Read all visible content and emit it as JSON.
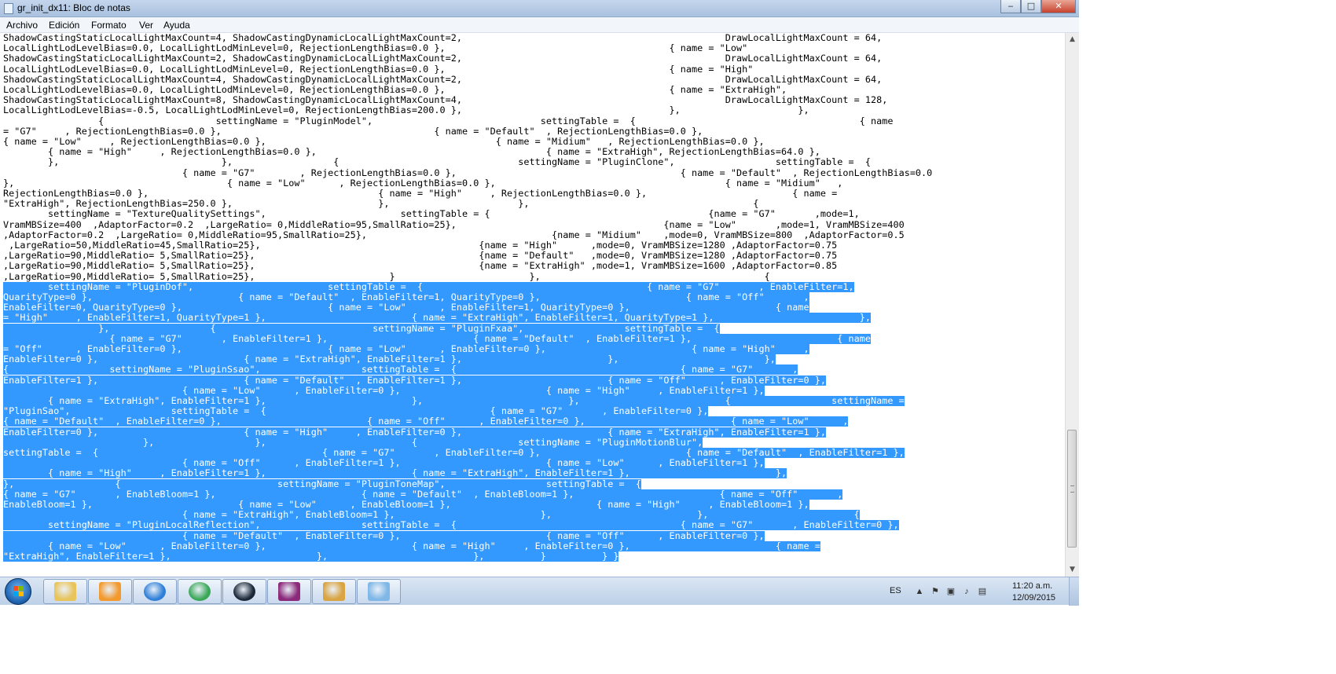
{
  "window": {
    "title": "gr_init_dx11: Bloc de notas"
  },
  "window_buttons": {
    "minimize": "‒",
    "maximize": "□",
    "close": "✕"
  },
  "menu": {
    "items": [
      "Archivo",
      "Edición",
      "Formato",
      "Ver",
      "Ayuda"
    ]
  },
  "editor": {
    "lines": [
      {
        "text": "ShadowCastingStaticLocalLightMaxCount=4, ShadowCastingDynamicLocalLightMaxCount=2,                                               DrawLocalLightMaxCount = 64,",
        "sel": false
      },
      {
        "text": "LocalLightLodLevelBias=0.0, LocalLightLodMinLevel=0, RejectionLengthBias=0.0 },                                        { name = \"Low\"",
        "sel": false
      },
      {
        "text": "ShadowCastingStaticLocalLightMaxCount=2, ShadowCastingDynamicLocalLightMaxCount=2,                                               DrawLocalLightMaxCount = 64,",
        "sel": false
      },
      {
        "text": "LocalLightLodLevelBias=0.0, LocalLightLodMinLevel=0, RejectionLengthBias=0.0 },                                        { name = \"High\"",
        "sel": false
      },
      {
        "text": "ShadowCastingStaticLocalLightMaxCount=4, ShadowCastingDynamicLocalLightMaxCount=2,                                               DrawLocalLightMaxCount = 64,",
        "sel": false
      },
      {
        "text": "LocalLightLodLevelBias=0.0, LocalLightLodMinLevel=0, RejectionLengthBias=0.0 },                                        { name = \"ExtraHigh\",",
        "sel": false
      },
      {
        "text": "ShadowCastingStaticLocalLightMaxCount=8, ShadowCastingDynamicLocalLightMaxCount=4,                                               DrawLocalLightMaxCount = 128,",
        "sel": false
      },
      {
        "text": "LocalLightLodLevelBias=-0.5, LocalLightLodMinLevel=0, RejectionLengthBias=200.0 },                                     },                     },",
        "sel": false
      },
      {
        "text": "                 {                    settingName = \"PluginModel\",                              settingTable =  {                                        { name",
        "sel": false
      },
      {
        "text": "= \"G7\"     , RejectionLengthBias=0.0 },                                      { name = \"Default\"  , RejectionLengthBias=0.0 },",
        "sel": false
      },
      {
        "text": "{ name = \"Low\"     , RejectionLengthBias=0.0 },                                         { name = \"Midium\"   , RejectionLengthBias=0.0 },",
        "sel": false
      },
      {
        "text": "        { name = \"High\"     , RejectionLengthBias=0.0 },                                         { name = \"ExtraHigh\", RejectionLengthBias=64.0 },",
        "sel": false
      },
      {
        "text": "        },                             },                  {                                settingName = \"PluginClone\",                  settingTable =  {",
        "sel": false
      },
      {
        "text": "                                { name = \"G7\"        , RejectionLengthBias=0.0 },                                        { name = \"Default\"  , RejectionLengthBias=0.0",
        "sel": false
      },
      {
        "text": "},                                      { name = \"Low\"      , RejectionLengthBias=0.0 },                                         { name = \"Midium\"   ,",
        "sel": false
      },
      {
        "text": "RejectionLengthBias=0.0 },                                         { name = \"High\"     , RejectionLengthBias=0.0 },                          { name =",
        "sel": false
      },
      {
        "text": "\"ExtraHigh\", RejectionLengthBias=250.0 },                          },                       },                                        {",
        "sel": false
      },
      {
        "text": "        settingName = \"TextureQualitySettings\",                        settingTable = {                                       {name = \"G7\"       ,mode=1,",
        "sel": false
      },
      {
        "text": "VramMBSize=400  ,AdaptorFactor=0.2  ,LargeRatio= 0,MiddleRatio=95,SmallRatio=25},                                     {name = \"Low\"       ,mode=1, VramMBSize=400",
        "sel": false
      },
      {
        "text": ",AdaptorFactor=0.2  ,LargeRatio= 0,MiddleRatio=95,SmallRatio=25},                                 {name = \"Midium\"    ,mode=0, VramMBSize=800  ,AdaptorFactor=0.5",
        "sel": false
      },
      {
        "text": " ,LargeRatio=50,MiddleRatio=45,SmallRatio=25},                                       {name = \"High\"      ,mode=0, VramMBSize=1280 ,AdaptorFactor=0.75",
        "sel": false
      },
      {
        "text": ",LargeRatio=90,MiddleRatio= 5,SmallRatio=25},                                        {name = \"Default\"   ,mode=0, VramMBSize=1280 ,AdaptorFactor=0.75",
        "sel": false
      },
      {
        "text": ",LargeRatio=90,MiddleRatio= 5,SmallRatio=25},                                        {name = \"ExtraHigh\" ,mode=1, VramMBSize=1600 ,AdaptorFactor=0.85",
        "sel": false
      },
      {
        "text": ",LargeRatio=90,MiddleRatio= 5,SmallRatio=25},                        }                        },                                        {",
        "sel": false
      },
      {
        "text": "        settingName = \"PluginDof\",                        settingTable =  {                                        { name = \"G7\"       , EnableFilter=1,",
        "sel": true
      },
      {
        "text": "QuarityType=0 },                          { name = \"Default\"  , EnableFilter=1, QuarityType=0 },                          { name = \"Off\"       ,",
        "sel": true
      },
      {
        "text": "EnableFilter=0, QuarityType=0 },                          { name = \"Low\"      , EnableFilter=1, QuarityType=0 },                          { name",
        "sel": true
      },
      {
        "text": "= \"High\"     , EnableFilter=1, QuarityType=1 },                          { name = \"ExtraHigh\", EnableFilter=1, QuarityType=1 },                          },",
        "sel": true
      },
      {
        "text": "                 },                  {                            settingName = \"PluginFxaa\",                  settingTable =  {",
        "sel": true
      },
      {
        "text": "                   { name = \"G7\"       , EnableFilter=1 },                          { name = \"Default\"  , EnableFilter=1 },                          { name",
        "sel": true
      },
      {
        "text": "= \"Off\"      , EnableFilter=0 },                          { name = \"Low\"      , EnableFilter=0 },                          { name = \"High\"     ,",
        "sel": true
      },
      {
        "text": "EnableFilter=0 },                          { name = \"ExtraHigh\", EnableFilter=1 },                          },                          },",
        "sel": true
      },
      {
        "text": "{                  settingName = \"PluginSsao\",                  settingTable =  {                                        { name = \"G7\"       ,",
        "sel": true
      },
      {
        "text": "EnableFilter=1 },                          { name = \"Default\"  , EnableFilter=1 },                          { name = \"Off\"      , EnableFilter=0 },",
        "sel": true
      },
      {
        "text": "                                { name = \"Low\"      , EnableFilter=0 },                          { name = \"High\"     , EnableFilter=1 },",
        "sel": true
      },
      {
        "text": "        { name = \"ExtraHigh\", EnableFilter=1 },                          },                          },                          {                  settingName =",
        "sel": true
      },
      {
        "text": "\"PluginSao\",                  settingTable =  {                                        { name = \"G7\"       , EnableFilter=0 },",
        "sel": true
      },
      {
        "text": "{ name = \"Default\"  , EnableFilter=0 },                          { name = \"Off\"      , EnableFilter=0 },                          { name = \"Low\"      ,",
        "sel": true
      },
      {
        "text": "EnableFilter=0 },                          { name = \"High\"     , EnableFilter=0 },                          { name = \"ExtraHigh\", EnableFilter=1 },",
        "sel": true
      },
      {
        "text": "                         },                  },                          {                  settingName = \"PluginMotionBlur\",",
        "sel": true
      },
      {
        "text": "settingTable =  {                                        { name = \"G7\"       , EnableFilter=0 },                          { name = \"Default\"  , EnableFilter=1 },",
        "sel": true
      },
      {
        "text": "                                { name = \"Off\"      , EnableFilter=1 },                          { name = \"Low\"      , EnableFilter=1 },",
        "sel": true
      },
      {
        "text": "        { name = \"High\"     , EnableFilter=1 },                          { name = \"ExtraHigh\", EnableFilter=1 },                          },",
        "sel": true
      },
      {
        "text": "},                  {                            settingName = \"PluginToneMap\",                  settingTable =  {",
        "sel": true
      },
      {
        "text": "{ name = \"G7\"       , EnableBloom=1 },                          { name = \"Default\"  , EnableBloom=1 },                          { name = \"Off\"       ,",
        "sel": true
      },
      {
        "text": "EnableBloom=1 },                          { name = \"Low\"      , EnableBloom=1 },                          { name = \"High\"     , EnableBloom=1 },",
        "sel": true
      },
      {
        "text": "                                { name = \"ExtraHigh\", EnableBloom=1 },                          },                          },                          {",
        "sel": true
      },
      {
        "text": "        settingName = \"PluginLocalReflection\",                  settingTable =  {                                        { name = \"G7\"       , EnableFilter=0 },",
        "sel": true
      },
      {
        "text": "                                { name = \"Default\"  , EnableFilter=0 },                          { name = \"Off\"      , EnableFilter=0 },",
        "sel": true
      },
      {
        "text": "        { name = \"Low\"      , EnableFilter=0 },                          { name = \"High\"     , EnableFilter=0 },                          { name =",
        "sel": true
      },
      {
        "text": "\"ExtraHigh\", EnableFilter=1 },                          },                          },          }          } }",
        "sel": true
      }
    ]
  },
  "taskbar": {
    "apps": [
      {
        "name": "explorer-icon",
        "color": "#e8c45a"
      },
      {
        "name": "media-player-icon",
        "color": "#f29a2e"
      },
      {
        "name": "internet-explorer-icon",
        "color": "#2f7fd8"
      },
      {
        "name": "chrome-icon",
        "color": "#3aa757"
      },
      {
        "name": "steam-icon",
        "color": "#1b2838"
      },
      {
        "name": "winrar-icon",
        "color": "#8b2a7a"
      },
      {
        "name": "paint-icon",
        "color": "#d9a441"
      },
      {
        "name": "notepad-icon",
        "color": "#7fb7e6"
      }
    ],
    "tray": {
      "language": "ES",
      "time": "11:20 a.m.",
      "date": "12/09/2015"
    }
  },
  "colors": {
    "selection": "#3399ff",
    "taskbar": "#c6d8ee"
  }
}
